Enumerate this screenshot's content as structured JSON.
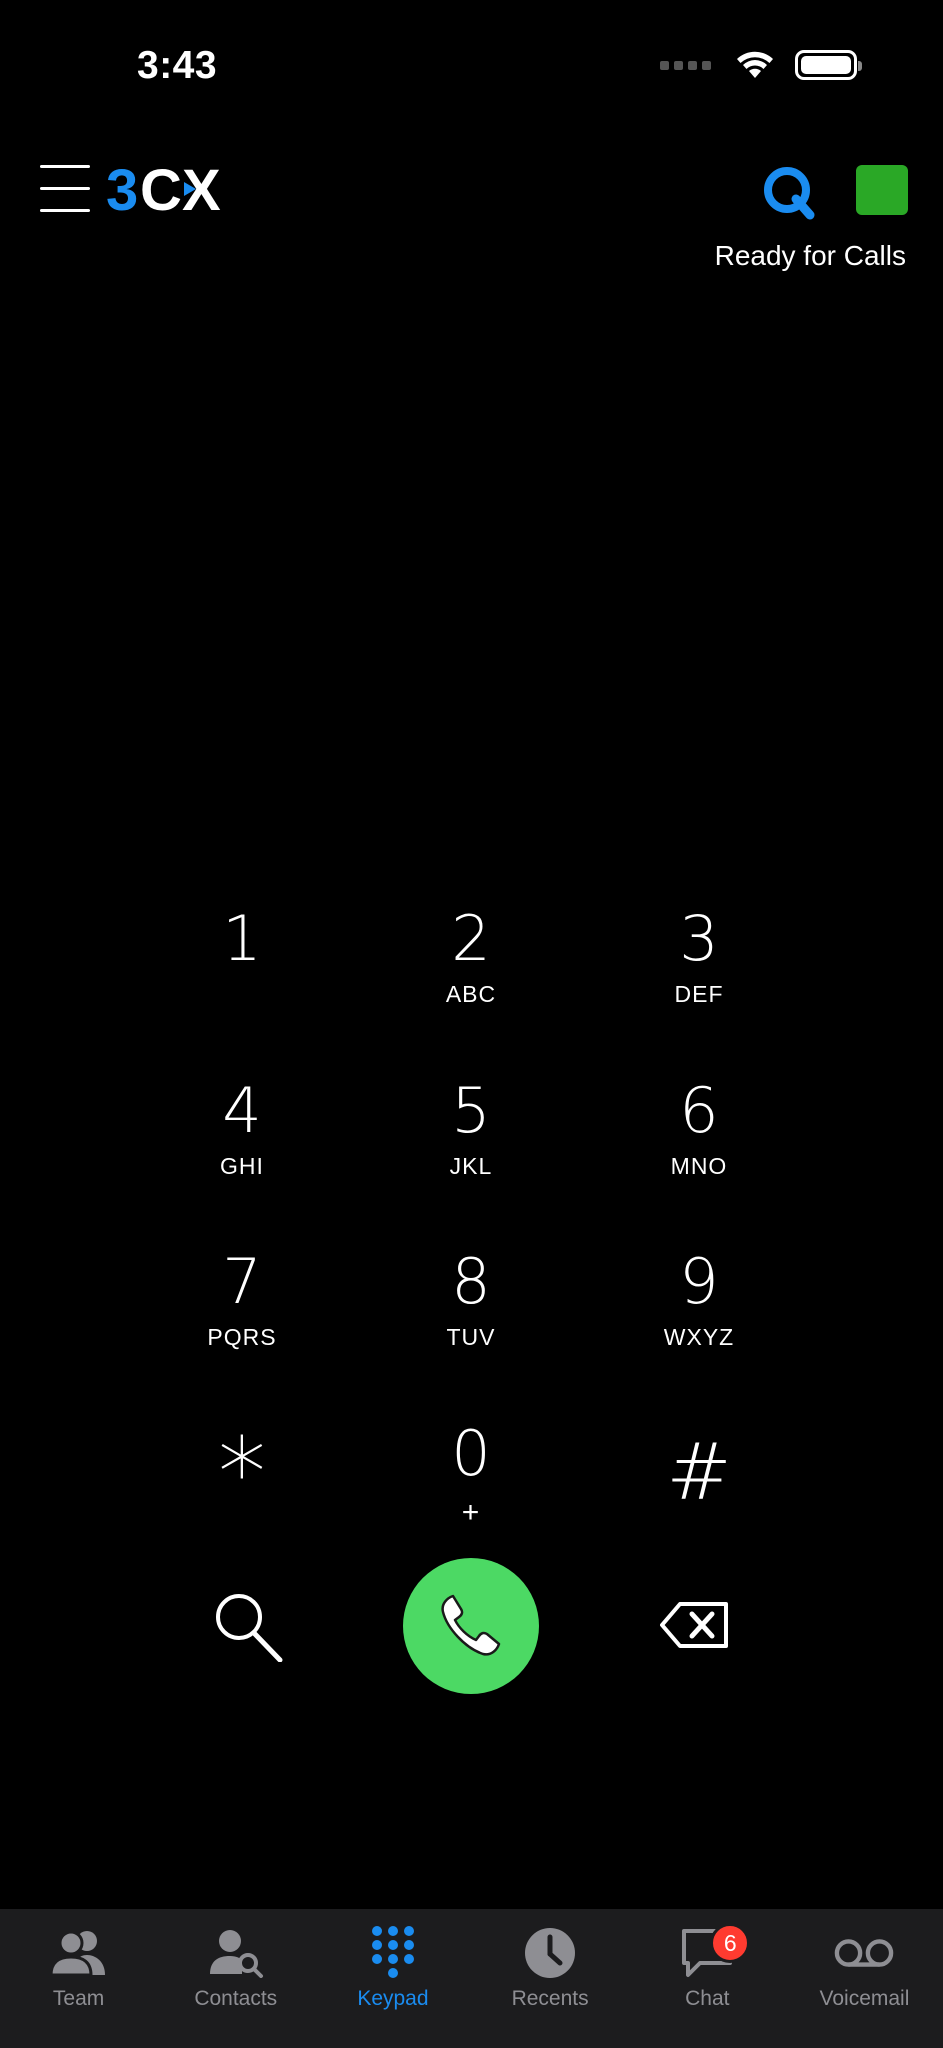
{
  "status_bar": {
    "time": "3:43"
  },
  "header": {
    "logo_text": "3CX",
    "status_text": "Ready for Calls",
    "status_color": "#2aa826",
    "accent_color": "#1a8cf0"
  },
  "keypad": {
    "keys": [
      {
        "digit": "1",
        "letters": ""
      },
      {
        "digit": "2",
        "letters": "ABC"
      },
      {
        "digit": "3",
        "letters": "DEF"
      },
      {
        "digit": "4",
        "letters": "GHI"
      },
      {
        "digit": "5",
        "letters": "JKL"
      },
      {
        "digit": "6",
        "letters": "MNO"
      },
      {
        "digit": "7",
        "letters": "PQRS"
      },
      {
        "digit": "8",
        "letters": "TUV"
      },
      {
        "digit": "9",
        "letters": "WXYZ"
      },
      {
        "digit": "*",
        "letters": ""
      },
      {
        "digit": "0",
        "letters": "+"
      },
      {
        "digit": "#",
        "letters": ""
      }
    ],
    "call_color": "#4cd964"
  },
  "tabbar": {
    "tabs": [
      {
        "label": "Team",
        "icon": "team-icon"
      },
      {
        "label": "Contacts",
        "icon": "contacts-search-icon"
      },
      {
        "label": "Keypad",
        "icon": "keypad-icon",
        "active": true
      },
      {
        "label": "Recents",
        "icon": "clock-icon"
      },
      {
        "label": "Chat",
        "icon": "chat-bubble-icon",
        "badge": "6"
      },
      {
        "label": "Voicemail",
        "icon": "voicemail-icon"
      }
    ]
  }
}
